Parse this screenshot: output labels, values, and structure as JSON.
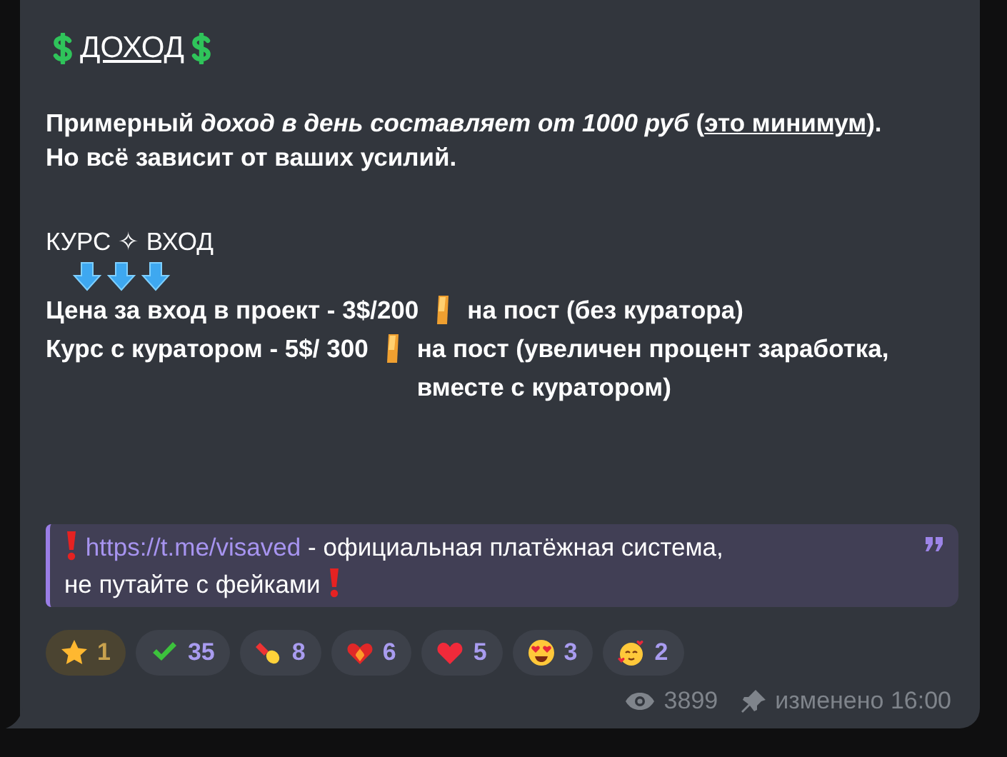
{
  "title": {
    "text": "ДОХОД"
  },
  "paragraph": [
    {
      "kind": "text",
      "text": "Примерный *доход в день составляет от 1000 руб* ("
    },
    {
      "kind": "link",
      "text": "это минимум"
    },
    {
      "kind": "text",
      "text": "). Но всё зависит от ваших усилий."
    }
  ],
  "course_header": "КУРС ✧ ВХОД",
  "prices": [
    {
      "before": "Цена за вход в проект - 3$/200",
      "after": "на пост (без куратора)"
    },
    {
      "before": "Курс с куратором - 5$/ 300",
      "after": "на пост (увеличен процент заработка, вместе с куратором)"
    }
  ],
  "quote": {
    "link": "https://t.me/visaved",
    "lines": [
      "- официальная платёжная система,",
      "не путайте с фейками"
    ]
  },
  "reactions": [
    {
      "kind": "star",
      "count": "1",
      "selected": true
    },
    {
      "kind": "check",
      "count": "35",
      "selected": false
    },
    {
      "kind": "pill",
      "count": "8",
      "selected": false
    },
    {
      "kind": "fire-heart",
      "count": "6",
      "selected": false
    },
    {
      "kind": "heart",
      "count": "5",
      "selected": false
    },
    {
      "kind": "heart-eyes",
      "count": "3",
      "selected": false
    },
    {
      "kind": "hearts-face",
      "count": "2",
      "selected": false
    }
  ],
  "footer": {
    "views": "3899",
    "status": "изменено 16:00"
  }
}
